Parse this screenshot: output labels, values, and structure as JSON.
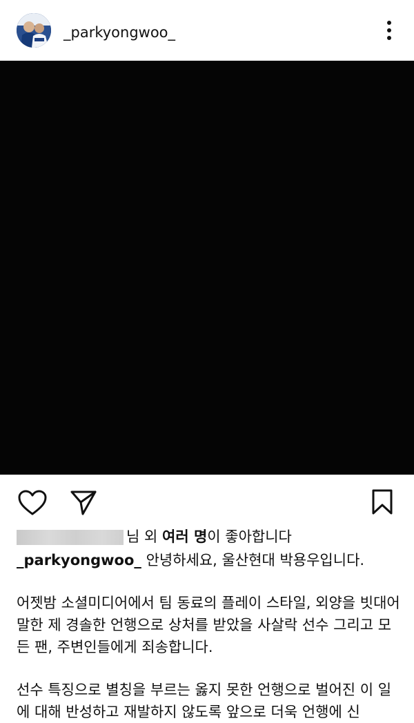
{
  "header": {
    "username": "_parkyongwoo_",
    "more_icon": "more-vertical-icon"
  },
  "post": {
    "image_color": "#050505"
  },
  "actions": {
    "like_icon": "heart-icon",
    "share_icon": "send-icon",
    "save_icon": "bookmark-icon"
  },
  "likes": {
    "obscured_suffix": "님",
    "prefix": " 외 ",
    "bold": "여러 명",
    "suffix": "이 좋아합니다"
  },
  "caption": {
    "author": "_parkyongwoo_",
    "first_line": " 안녕하세요, 울산현대 박용우입니다.",
    "paragraph_2": "어젯밤 소셜미디어에서 팀 동료의 플레이 스타일, 외양을 빗대어 말한 제 경솔한 언행으로 상처를 받았을 사살락 선수 그리고 모든 팬, 주변인들에게 죄송합니다.",
    "paragraph_3": "선수 특징으로 별칭을 부르는 옳지 못한 언행으로 벌어진 이 일에 대해 반성하고 재발하지 않도록 앞으로 더욱 언행에 신"
  }
}
